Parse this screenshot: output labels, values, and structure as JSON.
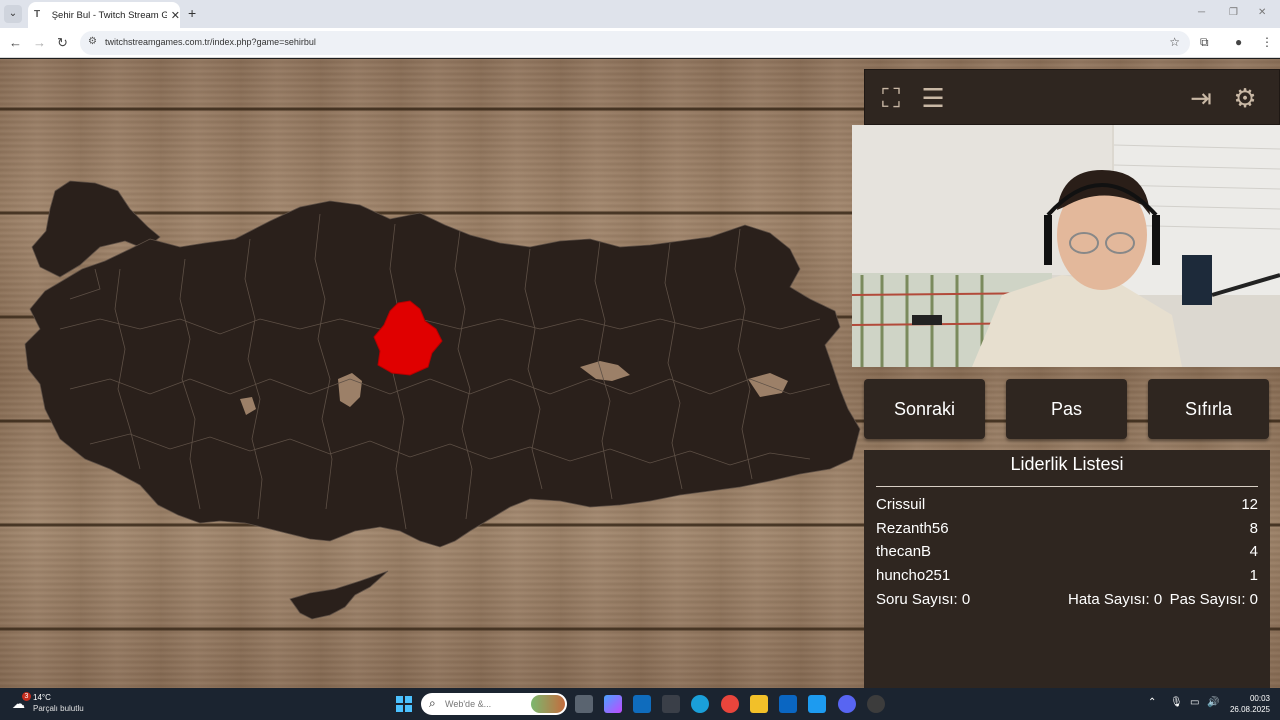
{
  "browser": {
    "tab_title": "Şehir Bul - Twitch Stream Game",
    "url": "twitchstreamgames.com.tr/index.php?game=sehirbul"
  },
  "controls": {
    "next_label": "Sonraki",
    "pass_label": "Pas",
    "reset_label": "Sıfırla"
  },
  "leaderboard": {
    "title": "Liderlik Listesi",
    "entries": [
      {
        "name": "Crissuil",
        "score": "12"
      },
      {
        "name": "Rezanth56",
        "score": "8"
      },
      {
        "name": "thecanB",
        "score": "4"
      },
      {
        "name": "huncho251",
        "score": "1"
      }
    ],
    "question_count": "Soru Sayısı: 0",
    "error_count": "Hata Sayısı: 0",
    "pass_count": "Pas Sayısı: 0"
  },
  "taskbar": {
    "weather_temp": "14°C",
    "weather_desc": "Parçalı bulutlu",
    "weather_badge": "3",
    "search_placeholder": "Web'de &...",
    "time": "00:03",
    "date": "26.08.2025"
  },
  "colors": {
    "highlight_province": "#e00000",
    "map_fill": "#2a201b",
    "panel": "#2f2620"
  },
  "icons": [
    "fullscreen-icon",
    "notes-icon",
    "logout-icon",
    "settings-icon"
  ]
}
